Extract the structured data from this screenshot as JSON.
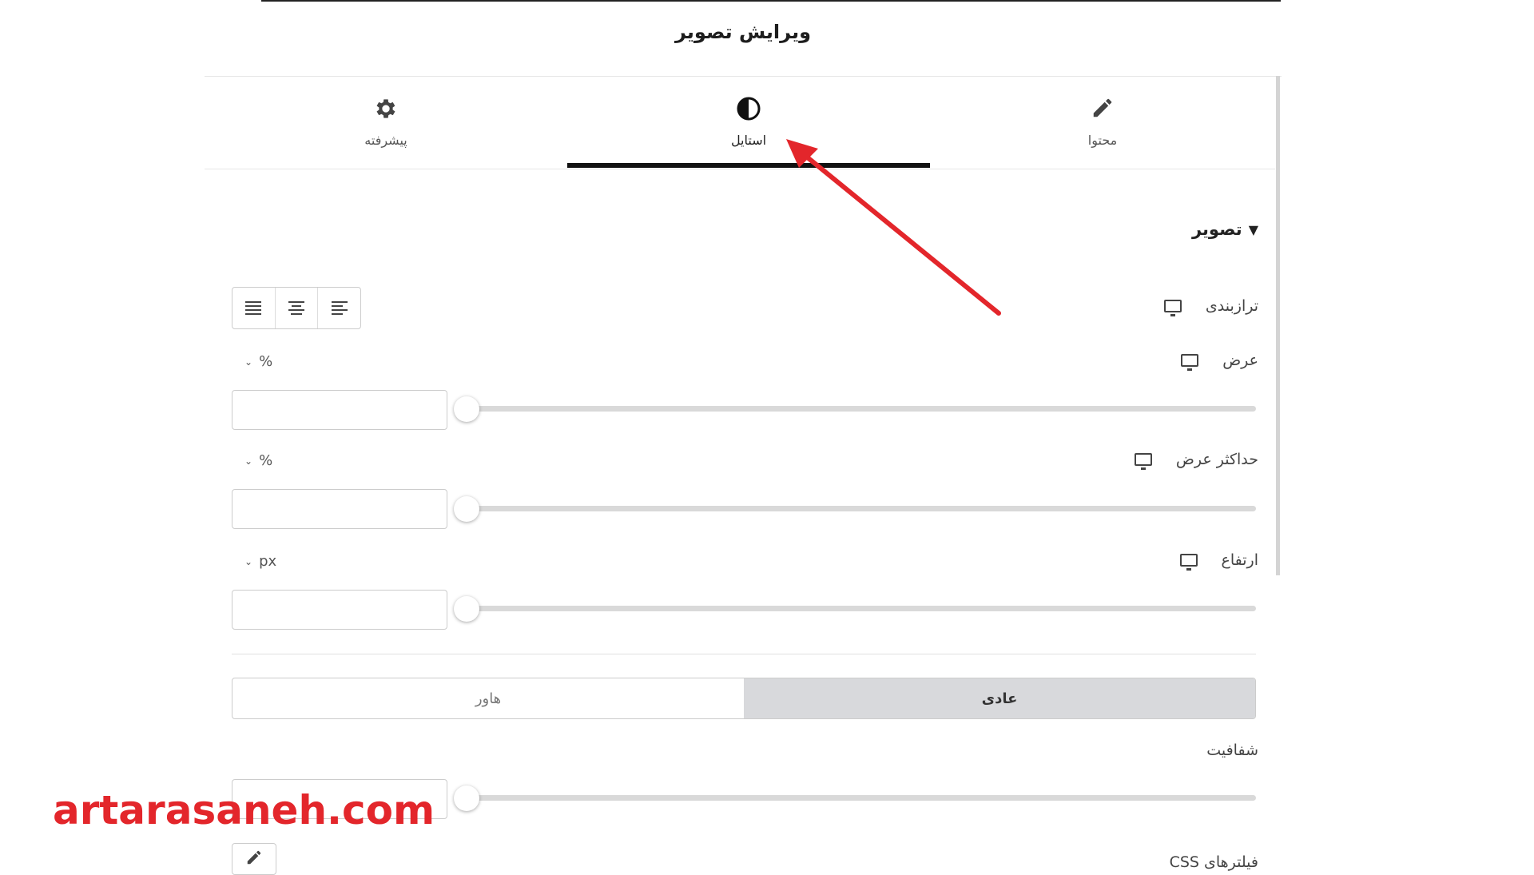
{
  "header": {
    "title": "ویرایش تصویر"
  },
  "tabs": [
    {
      "label": "پیشرفته",
      "icon": "gear-icon"
    },
    {
      "label": "استایل",
      "icon": "contrast-icon",
      "active": true
    },
    {
      "label": "محتوا",
      "icon": "pencil-icon"
    }
  ],
  "section": {
    "title": "تصویر",
    "icon": "caret-down-icon"
  },
  "controls": {
    "alignment": {
      "label": "ترازبندی",
      "options": [
        "justify",
        "center",
        "left"
      ]
    },
    "width": {
      "label": "عرض",
      "unit": "%",
      "value": ""
    },
    "max_width": {
      "label": "حداکثر عرض",
      "unit": "%",
      "value": ""
    },
    "height": {
      "label": "ارتفاع",
      "unit": "px",
      "value": ""
    },
    "states": {
      "normal": "عادی",
      "hover": "هاور",
      "active": "normal"
    },
    "opacity": {
      "label": "شفافیت",
      "value": ""
    },
    "css_filters": {
      "label": "فیلترهای CSS"
    }
  },
  "watermark": "artarasaneh.com",
  "colors": {
    "arrow": "#e3262b",
    "watermark": "#e3262b",
    "active_segment": "#d8d9dc"
  }
}
